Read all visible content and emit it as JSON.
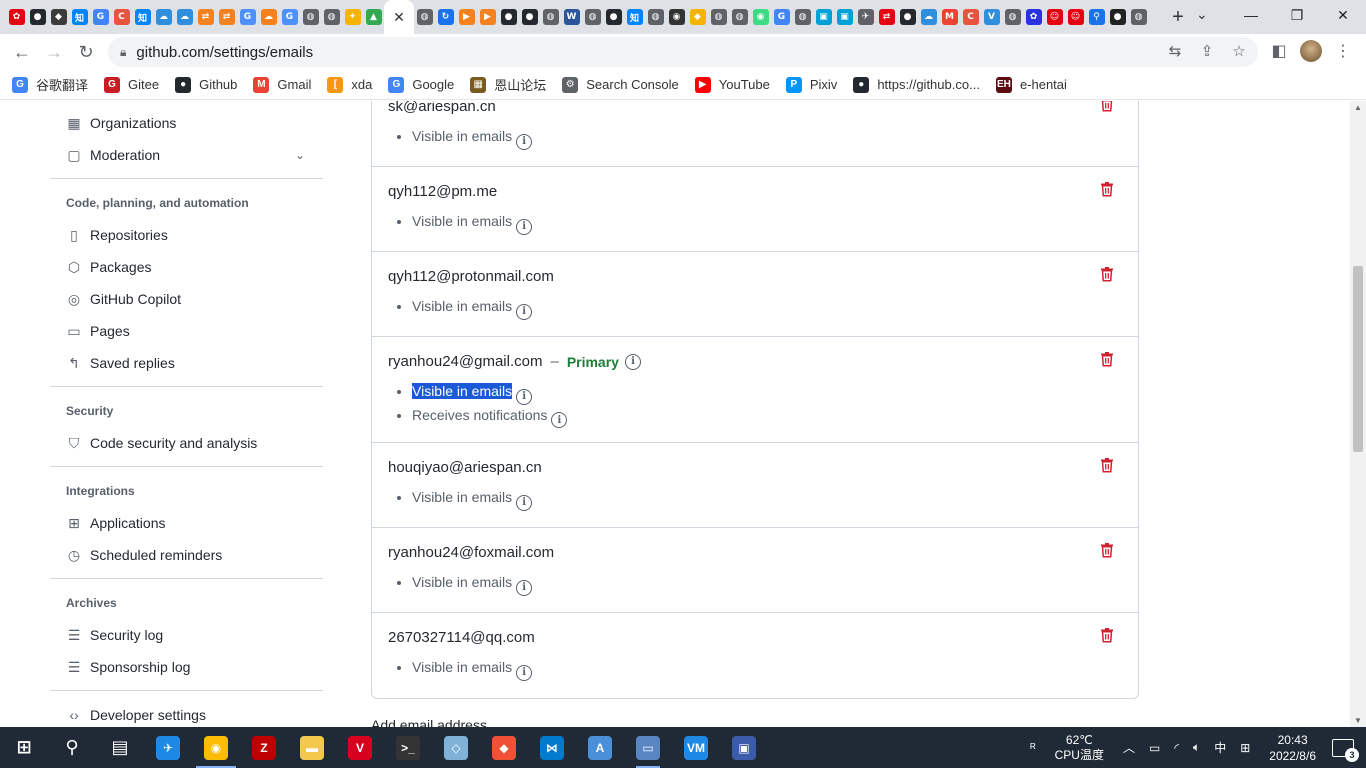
{
  "browser": {
    "favicon_tabs": [
      {
        "icon": "huawei-icon",
        "color": "#e60012",
        "glyph": "✿"
      },
      {
        "icon": "github-icon",
        "color": "#24292f",
        "glyph": "●"
      },
      {
        "icon": "bitwarden-icon",
        "color": "#3c3c3c",
        "glyph": "◆"
      },
      {
        "icon": "zhihu-icon",
        "color": "#0084ff",
        "glyph": "知"
      },
      {
        "icon": "google-icon",
        "color": "#4285f4",
        "glyph": "G"
      },
      {
        "icon": "c-icon",
        "color": "#e8543f",
        "glyph": "C"
      },
      {
        "icon": "zhihu-icon",
        "color": "#0084ff",
        "glyph": "知"
      },
      {
        "icon": "cloud-icon",
        "color": "#2f8fdd",
        "glyph": "☁"
      },
      {
        "icon": "cloud-icon",
        "color": "#2f8fdd",
        "glyph": "☁"
      },
      {
        "icon": "bracket-icon",
        "color": "#f58220",
        "glyph": "⇄"
      },
      {
        "icon": "bracket-icon",
        "color": "#f58220",
        "glyph": "⇄"
      },
      {
        "icon": "translate-icon",
        "color": "#4d90fe",
        "glyph": "G"
      },
      {
        "icon": "cloud-orange-icon",
        "color": "#f6821f",
        "glyph": "☁"
      },
      {
        "icon": "translate-icon",
        "color": "#4d90fe",
        "glyph": "G"
      },
      {
        "icon": "globe-icon",
        "color": "#5f6368",
        "glyph": "◍"
      },
      {
        "icon": "globe-icon",
        "color": "#5f6368",
        "glyph": "◍"
      },
      {
        "icon": "bell-icon",
        "color": "#f4b400",
        "glyph": "✦"
      },
      {
        "icon": "leaf-icon",
        "color": "#34a853",
        "glyph": "▲"
      }
    ],
    "active_tab_close": "✕",
    "favicon_tabs_right": [
      {
        "icon": "globe-icon",
        "color": "#5f6368",
        "glyph": "◍"
      },
      {
        "icon": "sync-icon",
        "color": "#1a73e8",
        "glyph": "↻"
      },
      {
        "icon": "flag-icon",
        "color": "#f58220",
        "glyph": "▶"
      },
      {
        "icon": "flag-icon",
        "color": "#f58220",
        "glyph": "▶"
      },
      {
        "icon": "github-icon",
        "color": "#24292f",
        "glyph": "●"
      },
      {
        "icon": "github-icon",
        "color": "#24292f",
        "glyph": "●"
      },
      {
        "icon": "globe-icon",
        "color": "#5f6368",
        "glyph": "◍"
      },
      {
        "icon": "word-icon",
        "color": "#2b579a",
        "glyph": "W"
      },
      {
        "icon": "globe-icon",
        "color": "#5f6368",
        "glyph": "◍"
      },
      {
        "icon": "github-icon",
        "color": "#24292f",
        "glyph": "●"
      },
      {
        "icon": "zhihu-icon",
        "color": "#0084ff",
        "glyph": "知"
      },
      {
        "icon": "globe-icon",
        "color": "#5f6368",
        "glyph": "◍"
      },
      {
        "icon": "owl-icon",
        "color": "#333333",
        "glyph": "◉"
      },
      {
        "icon": "shield-icon",
        "color": "#f4b400",
        "glyph": "◆"
      },
      {
        "icon": "globe-icon",
        "color": "#5f6368",
        "glyph": "◍"
      },
      {
        "icon": "globe-icon",
        "color": "#5f6368",
        "glyph": "◍"
      },
      {
        "icon": "android-icon",
        "color": "#3ddc84",
        "glyph": "◉"
      },
      {
        "icon": "google-icon",
        "color": "#4285f4",
        "glyph": "G"
      },
      {
        "icon": "globe-icon",
        "color": "#5f6368",
        "glyph": "◍"
      },
      {
        "icon": "tv-icon",
        "color": "#00a1d6",
        "glyph": "▣"
      },
      {
        "icon": "tv-icon",
        "color": "#00a1d6",
        "glyph": "▣"
      },
      {
        "icon": "plane-icon",
        "color": "#5f6368",
        "glyph": "✈"
      },
      {
        "icon": "bracket-icon",
        "color": "#e60012",
        "glyph": "⇄"
      },
      {
        "icon": "github-icon",
        "color": "#24292f",
        "glyph": "●"
      },
      {
        "icon": "cloud-icon",
        "color": "#2f8fdd",
        "glyph": "☁"
      },
      {
        "icon": "gmail-icon",
        "color": "#ea4335",
        "glyph": "M"
      },
      {
        "icon": "c-icon",
        "color": "#e8543f",
        "glyph": "C"
      },
      {
        "icon": "vs-icon",
        "color": "#2f8fdd",
        "glyph": "V"
      },
      {
        "icon": "globe-icon",
        "color": "#5f6368",
        "glyph": "◍"
      },
      {
        "icon": "baidu-icon",
        "color": "#2932e1",
        "glyph": "✿"
      },
      {
        "icon": "emoji-icon",
        "color": "#e60012",
        "glyph": "☺"
      },
      {
        "icon": "emoji-icon",
        "color": "#e60012",
        "glyph": "☺"
      },
      {
        "icon": "search-icon",
        "color": "#1a73e8",
        "glyph": "⚲"
      },
      {
        "icon": "circle-dark-icon",
        "color": "#222222",
        "glyph": "●"
      },
      {
        "icon": "globe-icon",
        "color": "#5f6368",
        "glyph": "◍"
      }
    ],
    "new_tab": "+",
    "url": "github.com/settings/emails",
    "bookmarks": [
      {
        "label": "谷歌翻译",
        "icon": "google-translate-icon",
        "color": "#4285f4",
        "glyph": "G"
      },
      {
        "label": "Gitee",
        "icon": "gitee-icon",
        "color": "#c71d23",
        "glyph": "G"
      },
      {
        "label": "Github",
        "icon": "github-icon",
        "color": "#24292f",
        "glyph": "●"
      },
      {
        "label": "Gmail",
        "icon": "gmail-icon",
        "color": "#ea4335",
        "glyph": "M"
      },
      {
        "label": "xda",
        "icon": "xda-icon",
        "color": "#f59714",
        "glyph": "["
      },
      {
        "label": "Google",
        "icon": "google-icon",
        "color": "#4285f4",
        "glyph": "G"
      },
      {
        "label": "恩山论坛",
        "icon": "enshan-icon",
        "color": "#7a5a1e",
        "glyph": "▦"
      },
      {
        "label": "Search Console",
        "icon": "search-console-icon",
        "color": "#5f6368",
        "glyph": "⚙"
      },
      {
        "label": "YouTube",
        "icon": "youtube-icon",
        "color": "#ff0000",
        "glyph": "▶"
      },
      {
        "label": "Pixiv",
        "icon": "pixiv-icon",
        "color": "#0096fa",
        "glyph": "P"
      },
      {
        "label": "https://github.co...",
        "icon": "github-icon",
        "color": "#24292f",
        "glyph": "●"
      },
      {
        "label": "e-hentai",
        "icon": "eh-icon",
        "color": "#5c0d12",
        "glyph": "EH"
      }
    ]
  },
  "sidebar": {
    "top_items": [
      {
        "label": "Organizations",
        "icon": "organization-icon",
        "glyph": "▦"
      },
      {
        "label": "Moderation",
        "icon": "report-icon",
        "glyph": "▢",
        "chevron": "⌄"
      }
    ],
    "sections": [
      {
        "heading": "Code, planning, and automation",
        "items": [
          {
            "label": "Repositories",
            "icon": "repo-icon",
            "glyph": "▯"
          },
          {
            "label": "Packages",
            "icon": "package-icon",
            "glyph": "⬡"
          },
          {
            "label": "GitHub Copilot",
            "icon": "copilot-icon",
            "glyph": "◎"
          },
          {
            "label": "Pages",
            "icon": "browser-icon",
            "glyph": "▭"
          },
          {
            "label": "Saved replies",
            "icon": "reply-icon",
            "glyph": "↰"
          }
        ]
      },
      {
        "heading": "Security",
        "items": [
          {
            "label": "Code security and analysis",
            "icon": "shield-lock-icon",
            "glyph": "⛉"
          }
        ]
      },
      {
        "heading": "Integrations",
        "items": [
          {
            "label": "Applications",
            "icon": "apps-icon",
            "glyph": "⊞"
          },
          {
            "label": "Scheduled reminders",
            "icon": "clock-icon",
            "glyph": "◷"
          }
        ]
      },
      {
        "heading": "Archives",
        "items": [
          {
            "label": "Security log",
            "icon": "log-icon",
            "glyph": "☰"
          },
          {
            "label": "Sponsorship log",
            "icon": "log-icon",
            "glyph": "☰"
          }
        ]
      }
    ],
    "bottom_item": {
      "label": "Developer settings",
      "icon": "code-icon",
      "glyph": "‹›"
    }
  },
  "emails": {
    "rows": [
      {
        "address": "sk@ariespan.cn",
        "primary": false,
        "meta": [
          "Visible in emails"
        ]
      },
      {
        "address": "qyh112@pm.me",
        "primary": false,
        "meta": [
          "Visible in emails"
        ]
      },
      {
        "address": "qyh112@protonmail.com",
        "primary": false,
        "meta": [
          "Visible in emails"
        ]
      },
      {
        "address": "ryanhou24@gmail.com",
        "primary": true,
        "primary_label": "Primary",
        "meta": [
          "Visible in emails",
          "Receives notifications"
        ]
      },
      {
        "address": "houqiyao@ariespan.cn",
        "primary": false,
        "meta": [
          "Visible in emails"
        ]
      },
      {
        "address": "ryanhou24@foxmail.com",
        "primary": false,
        "meta": [
          "Visible in emails"
        ]
      },
      {
        "address": "2670327114@qq.com",
        "primary": false,
        "meta": [
          "Visible in emails"
        ]
      }
    ],
    "add_heading": "Add email address"
  },
  "taskbar": {
    "apps": [
      {
        "icon": "start-icon",
        "color": "#ffffff",
        "glyph": "⊞",
        "state": ""
      },
      {
        "icon": "search-icon",
        "color": "#ffffff",
        "glyph": "⚲",
        "state": ""
      },
      {
        "icon": "task-view-icon",
        "color": "#ffffff",
        "glyph": "▤",
        "state": ""
      },
      {
        "icon": "app-blue-icon",
        "color": "#1e88e5",
        "glyph": "✈",
        "state": ""
      },
      {
        "icon": "chrome-icon",
        "color": "#fbbc05",
        "glyph": "◉",
        "state": "active"
      },
      {
        "icon": "filezilla-icon",
        "color": "#bf0000",
        "glyph": "Z",
        "state": ""
      },
      {
        "icon": "file-explorer-icon",
        "color": "#f2c94c",
        "glyph": "▬",
        "state": ""
      },
      {
        "icon": "vivaldi-icon",
        "color": "#d8001f",
        "glyph": "V",
        "state": ""
      },
      {
        "icon": "terminal-icon",
        "color": "#333333",
        "glyph": ">_",
        "state": ""
      },
      {
        "icon": "app-glass-icon",
        "color": "#7fb2d6",
        "glyph": "◇",
        "state": ""
      },
      {
        "icon": "git-icon",
        "color": "#f05033",
        "glyph": "◆",
        "state": ""
      },
      {
        "icon": "vscode-icon",
        "color": "#007acc",
        "glyph": "⋈",
        "state": ""
      },
      {
        "icon": "paint-icon",
        "color": "#4a90d9",
        "glyph": "A",
        "state": ""
      },
      {
        "icon": "remote-desktop-icon",
        "color": "#5a87c4",
        "glyph": "▭",
        "state": "running"
      },
      {
        "icon": "vmware-icon",
        "color": "#1e88e5",
        "glyph": "VM",
        "state": ""
      },
      {
        "icon": "network-app-icon",
        "color": "#3b5bab",
        "glyph": "▣",
        "state": ""
      }
    ],
    "tray": {
      "temp": "62℃",
      "temp_label": "CPU温度",
      "ime": "中",
      "time": "20:43",
      "date": "2022/8/6",
      "notifications": "3"
    }
  }
}
